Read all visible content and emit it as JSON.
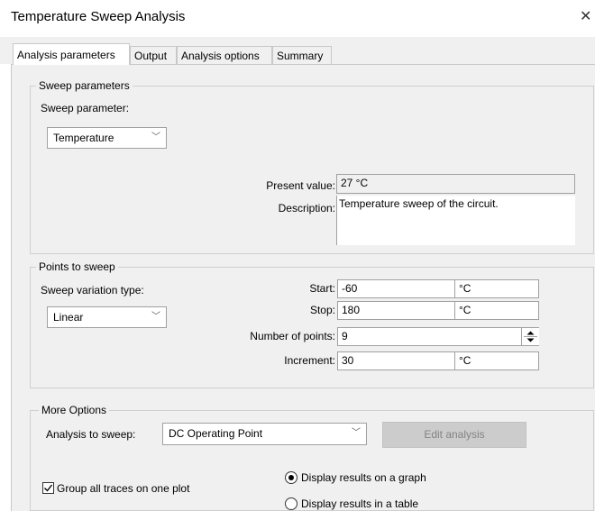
{
  "window": {
    "title": "Temperature Sweep Analysis",
    "close_icon": "close-icon"
  },
  "tabs": [
    {
      "label": "Analysis parameters",
      "active": true
    },
    {
      "label": "Output",
      "active": false
    },
    {
      "label": "Analysis options",
      "active": false
    },
    {
      "label": "Summary",
      "active": false
    }
  ],
  "sweep": {
    "group_label": "Sweep parameters",
    "param_label": "Sweep parameter:",
    "param_value": "Temperature",
    "present_label": "Present value:",
    "present_value": "27 °C",
    "description_label": "Description:",
    "description_value": "Temperature sweep of the circuit."
  },
  "points": {
    "group_label": "Points to sweep",
    "variation_label": "Sweep variation type:",
    "variation_value": "Linear",
    "start_label": "Start:",
    "start_value": "-60",
    "start_unit": "°C",
    "stop_label": "Stop:",
    "stop_value": "180",
    "stop_unit": "°C",
    "count_label": "Number of points:",
    "count_value": "9",
    "increment_label": "Increment:",
    "increment_value": "30",
    "increment_unit": "°C"
  },
  "more": {
    "group_label": "More Options",
    "analysis_label": "Analysis to sweep:",
    "analysis_value": "DC Operating Point",
    "edit_button": "Edit analysis",
    "group_traces_label": "Group all traces on one plot",
    "group_traces_checked": true,
    "radio_graph_label": "Display results on a graph",
    "radio_table_label": "Display results in a table",
    "selected_display": "graph"
  }
}
